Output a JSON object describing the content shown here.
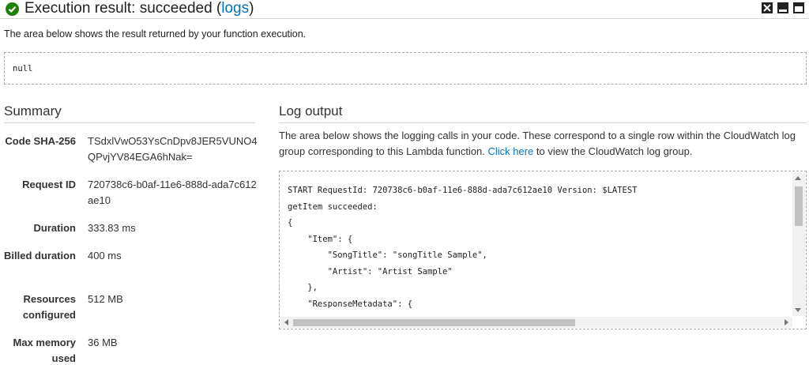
{
  "header": {
    "title_prefix": "Execution result: succeeded (",
    "logs_link": "logs",
    "title_suffix": ")"
  },
  "result": {
    "description": "The area below shows the result returned by your function execution.",
    "value": "null"
  },
  "summary": {
    "title": "Summary",
    "rows": [
      {
        "label": "Code SHA-256",
        "value": "TSdxlVwO53YsCnDpv8JER5VUNO4QPvjYV84EGA6hNak="
      },
      {
        "label": "Request ID",
        "value": "720738c6-b0af-11e6-888d-ada7c612ae10"
      },
      {
        "label": "Duration",
        "value": "333.83 ms"
      },
      {
        "label": "Billed duration",
        "value": "400 ms"
      },
      {
        "label": "Resources configured",
        "value": "512 MB"
      },
      {
        "label": "Max memory used",
        "value": "36 MB"
      }
    ]
  },
  "log": {
    "title": "Log output",
    "description_before": "The area below shows the logging calls in your code. These correspond to a single row within the CloudWatch log group corresponding to this Lambda function. ",
    "link_text": "Click here",
    "description_after": " to view the CloudWatch log group.",
    "lines": [
      "START RequestId: 720738c6-b0af-11e6-888d-ada7c612ae10 Version: $LATEST",
      "getItem succeeded:",
      "{",
      "    \"Item\": {",
      "        \"SongTitle\": \"songTitle Sample\",",
      "        \"Artist\": \"Artist Sample\"",
      "    },",
      "    \"ResponseMetadata\": {"
    ]
  }
}
